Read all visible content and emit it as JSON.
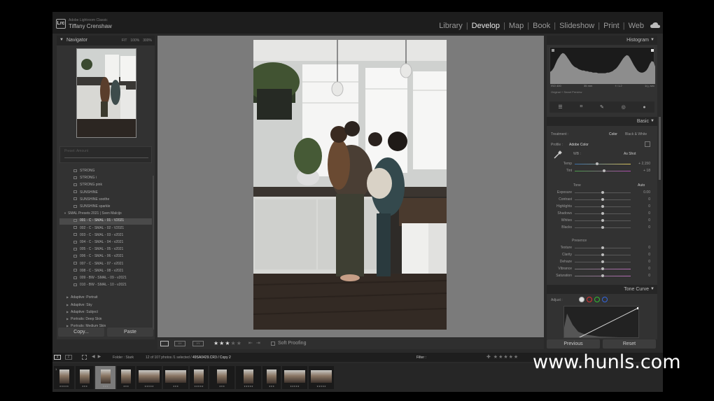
{
  "window": {
    "app_name": "Adobe Lightroom Classic",
    "user_name": "Tiffany Crenshaw",
    "logo_text": "Lrc"
  },
  "modules": [
    "Library",
    "Develop",
    "Map",
    "Book",
    "Slideshow",
    "Print",
    "Web"
  ],
  "active_module": "Develop",
  "navigator": {
    "title": "Navigator",
    "zoom_options": [
      "FIT",
      "100%",
      "300%"
    ]
  },
  "history": {
    "label": "Preset: Amount"
  },
  "presets": [
    {
      "type": "preset",
      "label": "STRONG"
    },
    {
      "type": "preset",
      "label": "STRONG i"
    },
    {
      "type": "preset",
      "label": "STRONG pink"
    },
    {
      "type": "preset",
      "label": "SUNSHINE"
    },
    {
      "type": "preset",
      "label": "SUNSHINE soothe"
    },
    {
      "type": "preset",
      "label": "SUNSHINE sparkle"
    },
    {
      "type": "group",
      "label": "SMAL Presets 2021 | Sven Malcijo"
    },
    {
      "type": "preset",
      "label": "001 - C - SMAL - 01 - V2021",
      "selected": true
    },
    {
      "type": "preset",
      "label": "002 - C - SMAL - 02 - V2021"
    },
    {
      "type": "preset",
      "label": "003 - C - SMAL - 03 - v2021"
    },
    {
      "type": "preset",
      "label": "004 - C - SMAL - 04 - v2021"
    },
    {
      "type": "preset",
      "label": "005 - C - SMAL - 05 - v2021"
    },
    {
      "type": "preset",
      "label": "006 - C - SMAL - 06 - v2021"
    },
    {
      "type": "preset",
      "label": "007 - C - SMAL - 07 - v2021"
    },
    {
      "type": "preset",
      "label": "008 - C - SMAL - 08 - v2021"
    },
    {
      "type": "preset",
      "label": "009 - BW - SMAL - 09 - v2021"
    },
    {
      "type": "preset",
      "label": "010 - BW - SMAL - 10 - v2021"
    },
    {
      "type": "folder",
      "label": "Adaptive: Portrait"
    },
    {
      "type": "folder",
      "label": "Adaptive: Sky"
    },
    {
      "type": "folder",
      "label": "Adaptive: Subject"
    },
    {
      "type": "folder",
      "label": "Portraits: Deep Skin"
    },
    {
      "type": "folder",
      "label": "Portraits: Medium Skin"
    }
  ],
  "left_buttons": {
    "copy": "Copy...",
    "paste": "Paste"
  },
  "toolbar": {
    "stars": "★★★",
    "stars_off": "★★",
    "soft_proofing": "Soft Proofing",
    "compare_label": "XY",
    "survey_label": "YY"
  },
  "histogram": {
    "title": "Histogram",
    "iso": "ISO 400",
    "focal": "35 mm",
    "aperture": "f / 1.2",
    "shutter": "1/₅₀ sec",
    "preview": "Original + Smart Preview",
    "data": [
      18,
      20,
      24,
      30,
      36,
      40,
      44,
      46,
      45,
      42,
      38,
      34,
      30,
      27,
      25,
      24,
      22,
      21,
      20,
      20,
      19,
      19,
      18,
      18,
      17,
      17,
      17,
      16,
      16,
      16,
      16,
      16,
      17,
      17,
      18,
      19,
      21,
      23,
      26,
      30,
      34,
      38,
      41,
      43,
      42,
      38,
      33,
      28,
      24,
      20,
      18,
      17,
      17,
      18,
      20,
      24,
      30,
      34,
      33,
      26
    ]
  },
  "basic": {
    "title": "Basic",
    "treatment_label": "Treatment :",
    "treatment_color": "Color",
    "treatment_bw": "Black & White",
    "profile_label": "Profile :",
    "profile_value": "Adobe Color",
    "wb_label": "WB :",
    "wb_value": "As Shot",
    "sliders_wb": [
      {
        "label": "Temp",
        "value": "+ 2,150",
        "pos": 0.4
      },
      {
        "label": "Tint",
        "value": "+ 18",
        "pos": 0.53
      }
    ],
    "tone_label": "Tone",
    "auto_label": "Auto",
    "sliders_tone": [
      {
        "label": "Exposure",
        "value": "0.00",
        "pos": 0.5
      },
      {
        "label": "Contrast",
        "value": "0",
        "pos": 0.5
      },
      {
        "label": "Highlights",
        "value": "0",
        "pos": 0.5
      },
      {
        "label": "Shadows",
        "value": "0",
        "pos": 0.5
      },
      {
        "label": "Whites",
        "value": "0",
        "pos": 0.5
      },
      {
        "label": "Blacks",
        "value": "0",
        "pos": 0.5
      }
    ],
    "presence_label": "Presence",
    "sliders_presence": [
      {
        "label": "Texture",
        "value": "0",
        "pos": 0.5
      },
      {
        "label": "Clarity",
        "value": "0",
        "pos": 0.5
      },
      {
        "label": "Dehaze",
        "value": "0",
        "pos": 0.5
      },
      {
        "label": "Vibrance",
        "value": "0",
        "pos": 0.5
      },
      {
        "label": "Saturation",
        "value": "0",
        "pos": 0.5
      }
    ]
  },
  "tone_curve": {
    "title": "Tone Curve",
    "adjust_label": "Adjust :"
  },
  "right_buttons": {
    "previous": "Previous",
    "reset": "Reset"
  },
  "filmbar": {
    "page1": "1",
    "page2": "2",
    "folder": "Folder : Stark",
    "photos": "12 of 107 photos /1 selected /",
    "filename": "49SA0429.CR3 / Copy 2",
    "filter_label": "Filter :"
  },
  "filmstrip": [
    {
      "num": "1",
      "w": 29,
      "orient": "v",
      "stars": "★★★★★"
    },
    {
      "num": "",
      "w": 26,
      "orient": "v",
      "stars": "★★★"
    },
    {
      "num": "",
      "w": 29,
      "orient": "v",
      "stars": "★★★",
      "selected": true
    },
    {
      "num": "",
      "w": 26,
      "orient": "v",
      "stars": "★★★"
    },
    {
      "num": "",
      "w": 36,
      "orient": "h",
      "stars": "★★★★★"
    },
    {
      "num": "",
      "w": 36,
      "orient": "h",
      "stars": "★★★"
    },
    {
      "num": "",
      "w": 26,
      "orient": "v",
      "stars": "★★★★★"
    },
    {
      "num": "",
      "w": 36,
      "orient": "v",
      "stars": "★★★"
    },
    {
      "num": "",
      "w": 36,
      "orient": "v",
      "stars": "★★★★★"
    },
    {
      "num": "",
      "w": 26,
      "orient": "v",
      "stars": "★★★"
    },
    {
      "num": "",
      "w": 36,
      "orient": "h",
      "stars": "★★★★★"
    },
    {
      "num": "",
      "w": 36,
      "orient": "h",
      "stars": "★★★★★"
    }
  ],
  "watermark": "www.hunls.com",
  "colors": {
    "panel": "#323232",
    "canvas": "#7b7b7b",
    "topbar": "#1d1d1d"
  }
}
